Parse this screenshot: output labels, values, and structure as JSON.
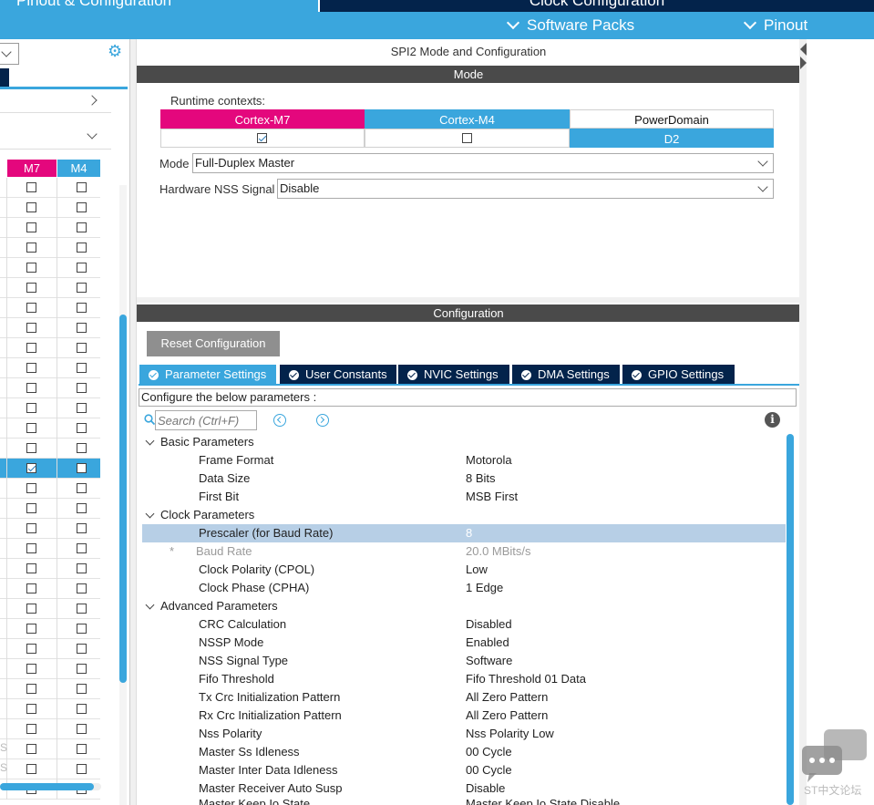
{
  "top_tabs": {
    "pinout": "Pinout & Configuration",
    "clock": "Clock Configuration"
  },
  "secondary_bar": {
    "software_packs": "Software Packs",
    "pinout": "Pinout"
  },
  "left_panel": {
    "col_m7": "M7",
    "col_m4": "M4",
    "rows": [
      {
        "m7": false,
        "m4": false
      },
      {
        "m7": false,
        "m4": false
      },
      {
        "m7": false,
        "m4": false
      },
      {
        "m7": false,
        "m4": false
      },
      {
        "m7": false,
        "m4": false
      },
      {
        "m7": false,
        "m4": false
      },
      {
        "m7": false,
        "m4": false
      },
      {
        "m7": false,
        "m4": false
      },
      {
        "m7": false,
        "m4": false
      },
      {
        "m7": false,
        "m4": false
      },
      {
        "m7": false,
        "m4": false
      },
      {
        "m7": false,
        "m4": false
      },
      {
        "m7": false,
        "m4": false
      },
      {
        "m7": false,
        "m4": false
      },
      {
        "m7": true,
        "m4": false,
        "selected": true
      },
      {
        "m7": false,
        "m4": false
      },
      {
        "m7": false,
        "m4": false
      },
      {
        "m7": false,
        "m4": false
      },
      {
        "m7": false,
        "m4": false
      },
      {
        "m7": false,
        "m4": false
      },
      {
        "m7": false,
        "m4": false
      },
      {
        "m7": false,
        "m4": false
      },
      {
        "m7": false,
        "m4": false
      },
      {
        "m7": false,
        "m4": false
      },
      {
        "m7": false,
        "m4": false
      },
      {
        "m7": false,
        "m4": false
      },
      {
        "m7": false,
        "m4": false
      },
      {
        "m7": false,
        "m4": false
      },
      {
        "m7": false,
        "m4": false
      },
      {
        "m7": false,
        "m4": false
      },
      {
        "m7": false,
        "m4": false
      }
    ],
    "ghost_s": "S"
  },
  "main": {
    "title": "SPI2 Mode and Configuration",
    "mode_section": "Mode",
    "runtime_contexts_label": "Runtime contexts:",
    "contexts": {
      "m7": "Cortex-M7",
      "m4": "Cortex-M4",
      "power_domain": "PowerDomain",
      "m7_checked": true,
      "m4_checked": false,
      "power_domain_value": "D2"
    },
    "mode_label": "Mode",
    "mode_value": "Full-Duplex Master",
    "nss_label": "Hardware NSS Signal",
    "nss_value": "Disable",
    "config_section": "Configuration",
    "reset_button": "Reset Configuration",
    "tabs": [
      "Parameter Settings",
      "User Constants",
      "NVIC Settings",
      "DMA Settings",
      "GPIO Settings"
    ],
    "param_description": "Configure the below parameters :",
    "search_placeholder": "Search (Ctrl+F)",
    "info_glyph": "i",
    "groups": {
      "basic": "Basic Parameters",
      "clock": "Clock Parameters",
      "advanced": "Advanced Parameters"
    },
    "params": {
      "frame_format": {
        "name": "Frame Format",
        "value": "Motorola"
      },
      "data_size": {
        "name": "Data Size",
        "value": "8 Bits"
      },
      "first_bit": {
        "name": "First Bit",
        "value": "MSB First"
      },
      "prescaler": {
        "name": "Prescaler (for Baud Rate)",
        "value": "8"
      },
      "baud_rate": {
        "star": "*",
        "name": "Baud Rate",
        "value": "20.0 MBits/s"
      },
      "cpol": {
        "name": "Clock Polarity (CPOL)",
        "value": "Low"
      },
      "cpha": {
        "name": "Clock Phase (CPHA)",
        "value": "1 Edge"
      },
      "crc": {
        "name": "CRC Calculation",
        "value": "Disabled"
      },
      "nssp": {
        "name": "NSSP Mode",
        "value": "Enabled"
      },
      "nss_type": {
        "name": "NSS Signal Type",
        "value": "Software"
      },
      "fifo": {
        "name": "Fifo Threshold",
        "value": "Fifo Threshold 01 Data"
      },
      "tx_crc": {
        "name": "Tx Crc Initialization Pattern",
        "value": "All Zero Pattern"
      },
      "rx_crc": {
        "name": "Rx Crc Initialization Pattern",
        "value": "All Zero Pattern"
      },
      "nss_pol": {
        "name": "Nss Polarity",
        "value": "Nss Polarity Low"
      },
      "ss_idle": {
        "name": "Master Ss Idleness",
        "value": "00 Cycle"
      },
      "inter_idle": {
        "name": "Master Inter Data Idleness",
        "value": "00 Cycle"
      },
      "auto_susp": {
        "name": "Master Receiver Auto Susp",
        "value": "Disable"
      },
      "keep_io": {
        "name": "Master Keep Io State",
        "value": "Master Keep Io State Disable"
      }
    }
  },
  "watermark": "ST中文论坛",
  "colors": {
    "st_blue": "#3aa6dd",
    "st_navy": "#03234b",
    "m7_pink": "#e4077d",
    "section_gray": "#4a4a4a",
    "highlight_row": "#b7cfe6"
  }
}
